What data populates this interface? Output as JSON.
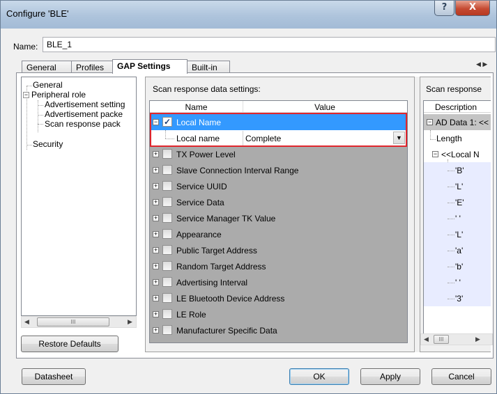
{
  "window": {
    "title": "Configure 'BLE'",
    "help_glyph": "?",
    "close_glyph": "X"
  },
  "name_field": {
    "label": "Name:",
    "value": "BLE_1"
  },
  "tabs": [
    {
      "label": "General",
      "active": false
    },
    {
      "label": "Profiles",
      "active": false
    },
    {
      "label": "GAP Settings",
      "active": true
    },
    {
      "label": "Built-in",
      "active": false
    }
  ],
  "tab_scroll_glyph": "◀ ▶",
  "tree": {
    "items": [
      {
        "label": "General"
      },
      {
        "label": "Peripheral role",
        "expander": "−"
      },
      {
        "label": "Advertisement setting"
      },
      {
        "label": "Advertisement packe"
      },
      {
        "label": "Scan response pack"
      },
      {
        "label": "Security"
      }
    ]
  },
  "scroll_glyphs": {
    "left": "◀",
    "right": "▶",
    "thumb": "III"
  },
  "scan_response": {
    "title": "Scan response data settings:",
    "columns": {
      "name": "Name",
      "value": "Value"
    },
    "expanded_item": {
      "label": "Local Name",
      "checked": true,
      "sub_name": "Local name",
      "sub_value": "Complete"
    },
    "items": [
      "TX Power Level",
      "Slave Connection Interval Range",
      "Service UUID",
      "Service Data",
      "Service Manager TK Value",
      "Appearance",
      "Public Target Address",
      "Random Target Address",
      "Advertising Interval",
      "LE Bluetooth Device Address",
      "LE Role",
      "Manufacturer Specific Data"
    ],
    "expander_plus": "+",
    "expander_minus": "−",
    "check_glyph": "✓",
    "dropdown_glyph": "▼"
  },
  "ad_panel": {
    "title": "Scan response",
    "column": "Description",
    "rows": [
      "AD Data 1: <<",
      "Length",
      "<<Local N",
      "'B'",
      "'L'",
      "'E'",
      "' '",
      "'L'",
      "'a'",
      "'b'",
      "' '",
      "'3'"
    ]
  },
  "buttons": {
    "restore_defaults": "Restore Defaults",
    "datasheet": "Datasheet",
    "ok": "OK",
    "apply": "Apply",
    "cancel": "Cancel"
  },
  "colors": {
    "selection": "#3399ff",
    "highlight_border": "#e0262d",
    "grid_background": "#ababab"
  }
}
